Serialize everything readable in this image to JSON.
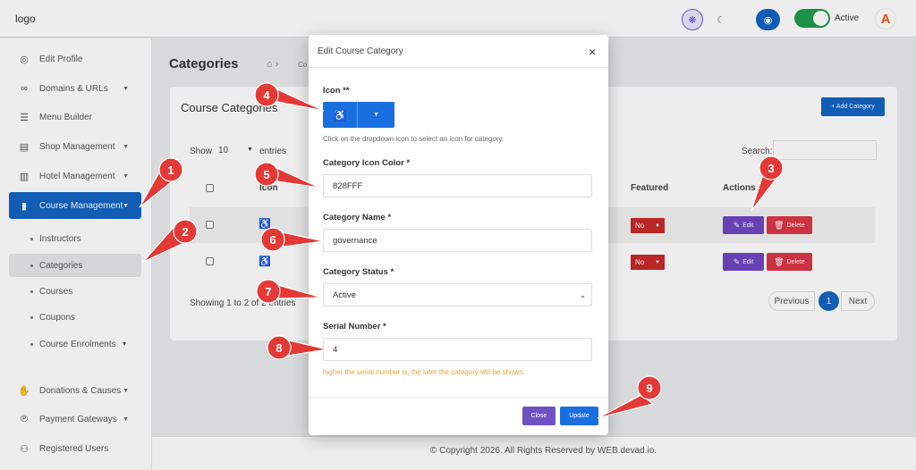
{
  "topbar": {
    "logo": "logo",
    "status_label": "Active",
    "avatar_letter": "A",
    "icons": [
      "palette-icon",
      "moon-icon",
      "eye-icon",
      "toggle-switch",
      "user-avatar"
    ]
  },
  "sidebar": {
    "items": [
      {
        "label": "Edit Profile",
        "icon": "user-circle-icon"
      },
      {
        "label": "Domains & URLs",
        "icon": "link-icon"
      },
      {
        "label": "Menu Builder",
        "icon": "bars-icon"
      },
      {
        "label": "Shop Management",
        "icon": "store-icon"
      },
      {
        "label": "Hotel Management",
        "icon": "building-icon"
      },
      {
        "label": "Course Management",
        "icon": "book-icon"
      }
    ],
    "course_sub": [
      "Instructors",
      "Categories",
      "Courses",
      "Coupons",
      "Course Enrolments"
    ],
    "bottom_items": [
      {
        "label": "Donations & Causes",
        "icon": "hand-coins-icon"
      },
      {
        "label": "Payment Gateways",
        "icon": "payment-icon"
      },
      {
        "label": "Registered Users",
        "icon": "users-icon"
      }
    ]
  },
  "page": {
    "title": "Categories",
    "crumb": "Co",
    "card_title": "Course Categories",
    "add_button": "+ Add Category",
    "show_label": "Show",
    "show_value": "10",
    "entries_label": "entries",
    "search_label": "Search:",
    "headers": {
      "icon": "Icon",
      "featured": "Featured",
      "actions": "Actions"
    },
    "rows": [
      {
        "icon_glyph": "♿",
        "featured": "No",
        "edit": "Edit",
        "delete": "Delete"
      },
      {
        "icon_glyph": "♿",
        "featured": "No",
        "edit": "Edit",
        "delete": "Delete"
      }
    ],
    "showing": "Showing 1 to 2 of 2 entries",
    "pagination": {
      "prev": "Previous",
      "current": "1",
      "next": "Next"
    },
    "footer": "© Copyright 2026. All Rights Reserved by WEB.devad.io."
  },
  "modal": {
    "title": "Edit Course Category",
    "close_glyph": "×",
    "icon_label": "Icon **",
    "icon_glyph": "♿",
    "icon_hint": "Click on the dropdown icon to select an icon for category.",
    "color_label": "Category Icon Color *",
    "color_value": "828FFF",
    "name_label": "Category Name *",
    "name_value": "governance",
    "status_label": "Category Status *",
    "status_value": "Active",
    "serial_label": "Serial Number *",
    "serial_value": "4",
    "serial_hint": "higher the serial number is, the later the category will be shown.",
    "close_button": "Close",
    "update_button": "Update"
  },
  "callouts": [
    "1",
    "2",
    "3",
    "4",
    "5",
    "6",
    "7",
    "8",
    "9"
  ],
  "colors": {
    "primary": "#1162c2",
    "active_toggle": "#1c9b4a",
    "callout": "#e53935",
    "edit": "#6e44c2",
    "delete": "#dc3545",
    "hint": "#e6a23c"
  }
}
